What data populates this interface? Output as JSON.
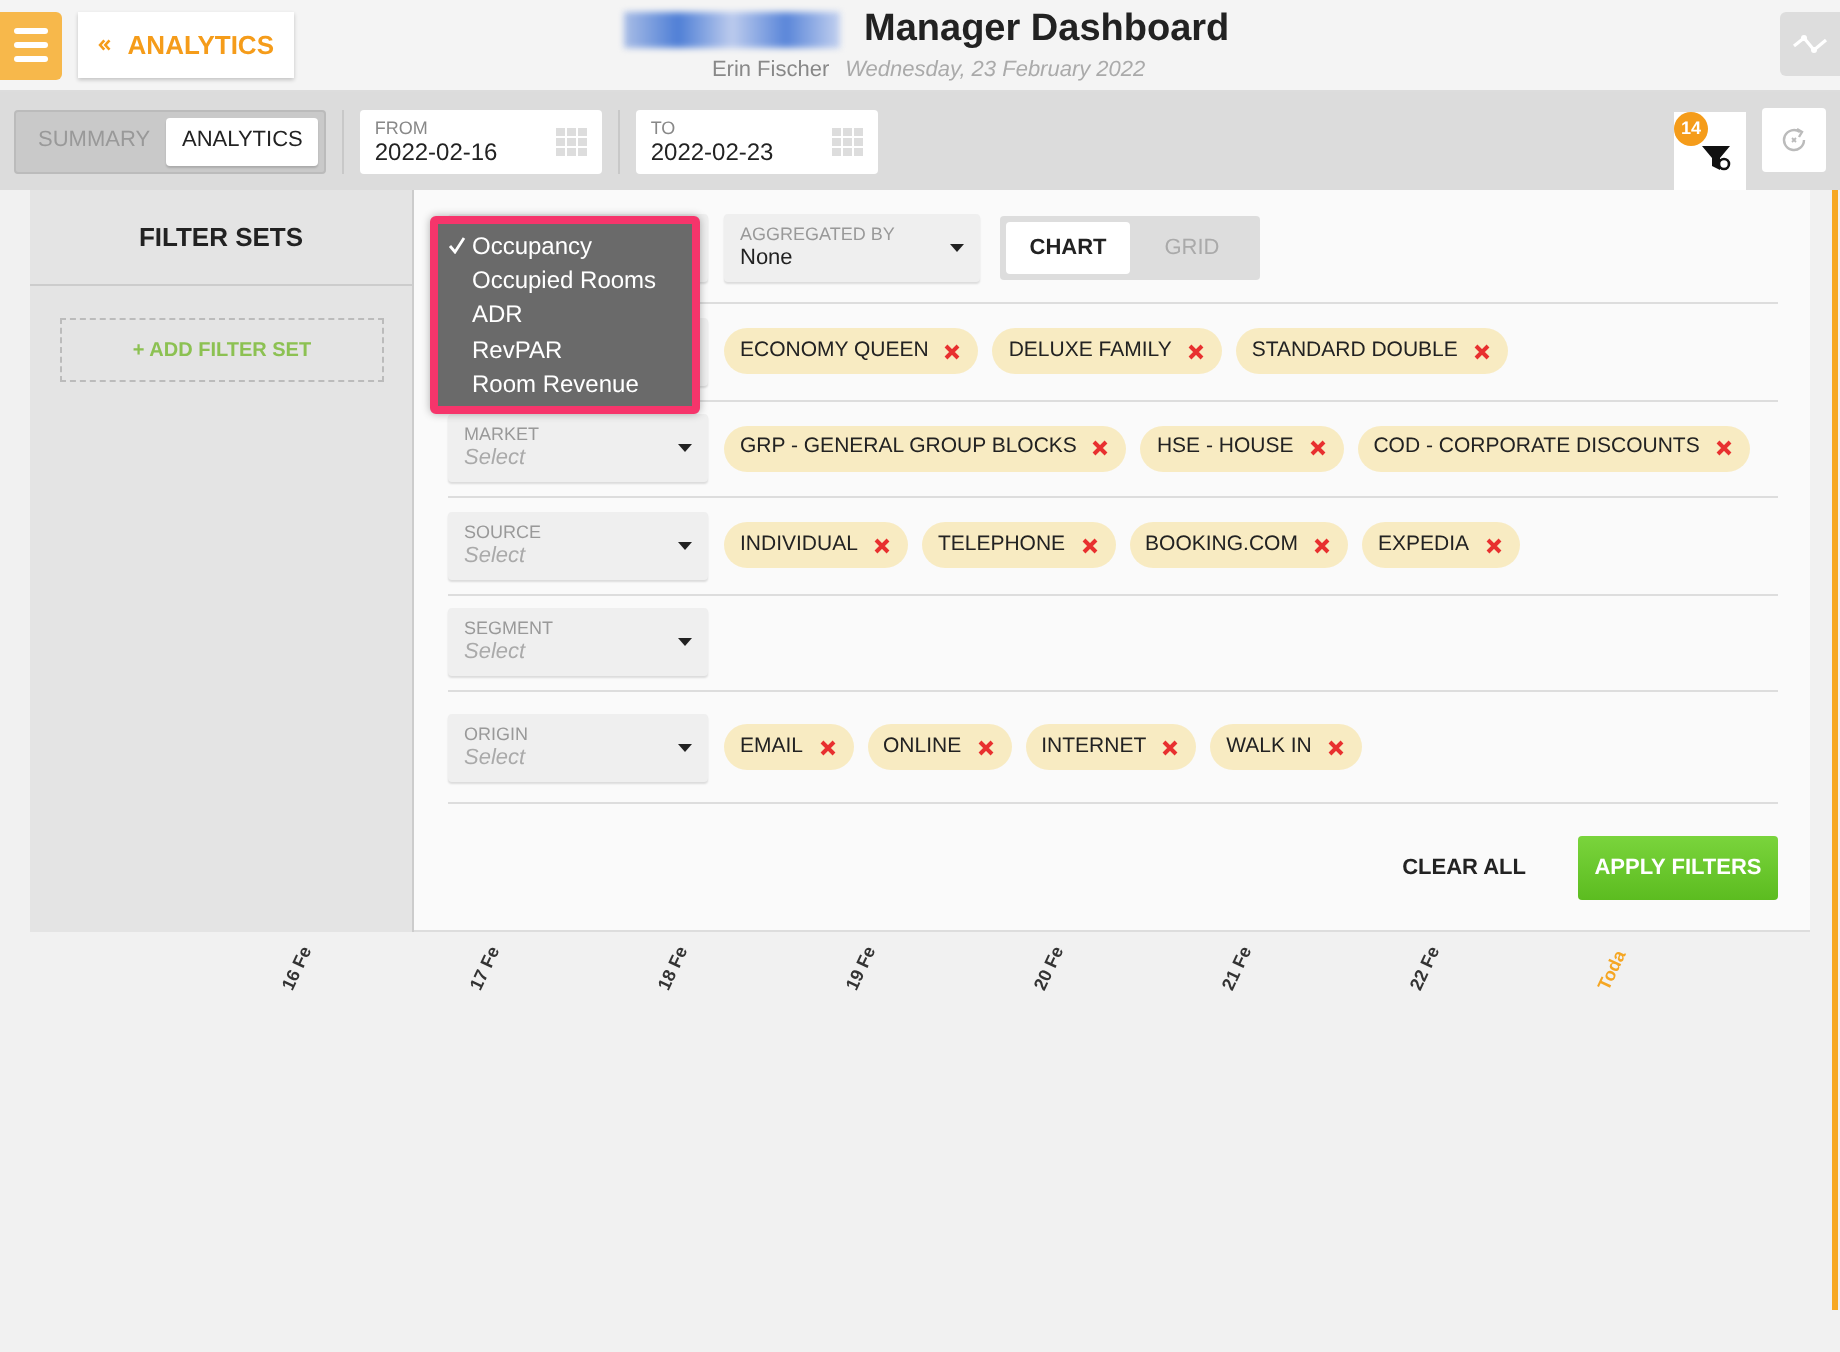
{
  "header": {
    "back_label": "ANALYTICS",
    "title": "Manager Dashboard",
    "user": "Erin Fischer",
    "date": "Wednesday, 23 February 2022"
  },
  "toolbar": {
    "views": [
      {
        "label": "SUMMARY",
        "selected": false
      },
      {
        "label": "ANALYTICS",
        "selected": true
      }
    ],
    "date_fields": [
      {
        "label": "FROM",
        "value": "2022-02-16"
      },
      {
        "label": "TO",
        "value": "2022-02-23"
      }
    ],
    "filter_count": "14"
  },
  "sidebar": {
    "title": "FILTER SETS",
    "add_button": "+ ADD FILTER SET"
  },
  "panel": {
    "metric_menu": [
      {
        "label": "Occupancy",
        "selected": true
      },
      {
        "label": "Occupied Rooms",
        "selected": false
      },
      {
        "label": "ADR",
        "selected": false
      },
      {
        "label": "RevPAR",
        "selected": false
      },
      {
        "label": "Room Revenue",
        "selected": false
      }
    ],
    "aggregated_by": {
      "label": "AGGREGATED BY",
      "value": "None"
    },
    "display_modes": [
      {
        "label": "CHART",
        "selected": true
      },
      {
        "label": "GRID",
        "selected": false
      }
    ],
    "filters": [
      {
        "chips": [
          "ECONOMY QUEEN",
          "DELUXE FAMILY",
          "STANDARD DOUBLE"
        ]
      },
      {
        "label": "MARKET",
        "placeholder": "Select",
        "chips": [
          "GRP - GENERAL GROUP BLOCKS",
          "HSE - HOUSE",
          "COD - CORPORATE DISCOUNTS"
        ]
      },
      {
        "label": "SOURCE",
        "placeholder": "Select",
        "chips": [
          "INDIVIDUAL",
          "TELEPHONE",
          "BOOKING.COM",
          "EXPEDIA"
        ]
      },
      {
        "label": "SEGMENT",
        "placeholder": "Select"
      },
      {
        "label": "ORIGIN",
        "placeholder": "Select",
        "chips": [
          "EMAIL",
          "ONLINE",
          "INTERNET",
          "WALK IN"
        ]
      }
    ],
    "clear_button": "CLEAR ALL",
    "apply_button": "APPLY FILTERS"
  },
  "axis_labels": [
    {
      "text": "16 Fe",
      "current": false
    },
    {
      "text": "17 Fe",
      "current": false
    },
    {
      "text": "18 Fe",
      "current": false
    },
    {
      "text": "19 Fe",
      "current": false
    },
    {
      "text": "20 Fe",
      "current": false
    },
    {
      "text": "21 Fe",
      "current": false
    },
    {
      "text": "22 Fe",
      "current": false
    },
    {
      "text": "Toda",
      "current": true
    }
  ]
}
